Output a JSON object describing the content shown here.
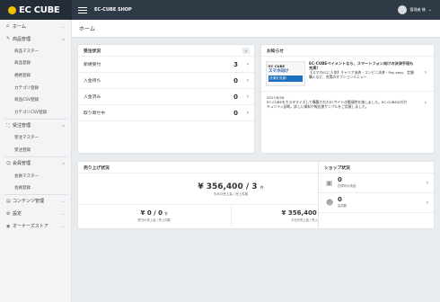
{
  "app": {
    "logo": "EC CUBE",
    "shop_name": "EC-CUBE SHOP",
    "user_name": "管理者 様"
  },
  "breadcrumb": "ホーム",
  "sidebar": {
    "items": [
      {
        "icon": "home-icon",
        "glyph": "⌂",
        "label": "ホーム",
        "expanded": false
      },
      {
        "icon": "tag-icon",
        "glyph": "✎",
        "label": "商品管理",
        "expanded": true,
        "children": [
          "商品マスター",
          "商品登録",
          "規格登録",
          "カテゴリ登録",
          "商品CSV登録",
          "カテゴリCSV登録"
        ]
      },
      {
        "icon": "cart-icon",
        "glyph": "⛶",
        "label": "受注管理",
        "expanded": true,
        "children": [
          "受注マスター",
          "受注登録"
        ]
      },
      {
        "icon": "user-icon",
        "glyph": "☺",
        "label": "会員管理",
        "expanded": true,
        "children": [
          "会員マスター",
          "会員登録"
        ]
      },
      {
        "icon": "document-icon",
        "glyph": "▤",
        "label": "コンテンツ管理",
        "expanded": false
      },
      {
        "icon": "gear-icon",
        "glyph": "⚙",
        "label": "設定",
        "expanded": false
      },
      {
        "icon": "plugin-icon",
        "glyph": "◉",
        "label": "オーナーズストア",
        "expanded": false
      }
    ]
  },
  "orders": {
    "title": "受注状況",
    "rows": [
      {
        "label": "新規受付",
        "count": "3"
      },
      {
        "label": "入金待ち",
        "count": "0"
      },
      {
        "label": "入金済み",
        "count": "0"
      },
      {
        "label": "取り寄せ中",
        "count": "0"
      }
    ]
  },
  "news": {
    "title": "お知らせ",
    "items": [
      {
        "thumb_logo": "EC CUBE",
        "thumb_text": "スマホ向け",
        "thumb_band": "決済を充実!",
        "headline": "EC-CUBEペイメントなら、スマートフォン向けの決済手段も充実!",
        "body": "【スマホECに人気】キャリア決済・コンビニ決済・Pay-easy、定額購入など、充実のオプションメニュー"
      }
    ],
    "second": {
      "date": "2017/6/26",
      "body": "EC-CUBEをカスタマイズして構築されたECサイトの脆弱性を施しました。EC-CUBE公式セキュリティ診断。詳しい資料や報告書サンプルをご用意しました。"
    }
  },
  "sales": {
    "title": "売り上げ状況",
    "month": {
      "amount": "¥ 356,400 / 3",
      "unit": "件",
      "label": "今月の売上高 / 売上件数"
    },
    "today": {
      "amount": "¥ 0 / 0",
      "unit": "件",
      "label": "昨日の売上高 / 売上件数"
    },
    "yesterday": {
      "amount": "¥ 356,400 / 3",
      "unit": "件",
      "label": "今日の売上高 / 売上件数"
    }
  },
  "shop": {
    "title": "ショップ状況",
    "rows": [
      {
        "value": "0",
        "label": "在庫切れ商品"
      },
      {
        "value": "0",
        "label": "会員数"
      }
    ]
  },
  "icons": {
    "arrow": "›",
    "collapse": "‹",
    "caret": "∧",
    "chevron": "⌄"
  },
  "colors": {
    "topbar": "#2e3a46",
    "logo_mark": "#f0c000"
  }
}
